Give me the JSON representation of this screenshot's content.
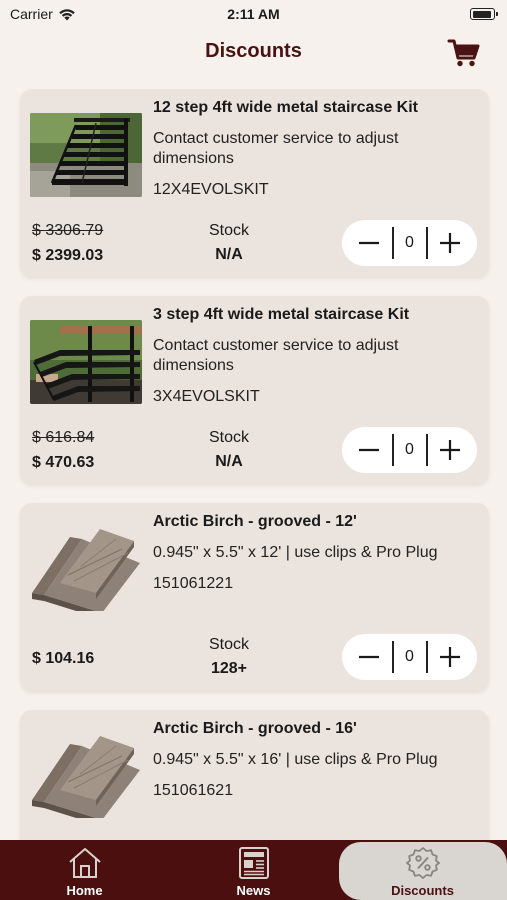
{
  "status_bar": {
    "carrier": "Carrier",
    "time": "2:11 AM",
    "battery_level": 0.95
  },
  "header": {
    "title": "Discounts"
  },
  "products": [
    {
      "title": "12 step 4ft wide metal staircase Kit",
      "description": "Contact customer service to adjust dimensions",
      "sku": "12X4EVOLSKIT",
      "old_price": "$ 3306.79",
      "price": "$ 2399.03",
      "stock_label": "Stock",
      "stock_value": "N/A",
      "quantity": "0",
      "image": "staircase-photo"
    },
    {
      "title": "3 step 4ft wide metal staircase Kit",
      "description": "Contact customer service to adjust dimensions",
      "sku": "3X4EVOLSKIT",
      "old_price": "$ 616.84",
      "price": "$ 470.63",
      "stock_label": "Stock",
      "stock_value": "N/A",
      "quantity": "0",
      "image": "staircase-photo"
    },
    {
      "title": "Arctic Birch - grooved - 12'",
      "description": "0.945\" x 5.5\" x 12' | use  clips & Pro Plug",
      "sku": "151061221",
      "price": "$ 104.16",
      "stock_label": "Stock",
      "stock_value": "128+",
      "quantity": "0",
      "image": "decking-boards"
    },
    {
      "title": "Arctic Birch - grooved - 16'",
      "description": "0.945\" x 5.5\" x 16' | use  clips & Pro Plug",
      "sku": "151061621",
      "image": "decking-boards"
    }
  ],
  "tabs": [
    {
      "label": "Home",
      "icon": "house-icon",
      "active": false
    },
    {
      "label": "News",
      "icon": "newspaper-icon",
      "active": false
    },
    {
      "label": "Discounts",
      "icon": "discount-badge-icon",
      "active": true
    }
  ],
  "colors": {
    "brand": "#4b0f0f",
    "title": "#4a1212",
    "background": "#f6f1ec",
    "card": "#ebe4de"
  }
}
